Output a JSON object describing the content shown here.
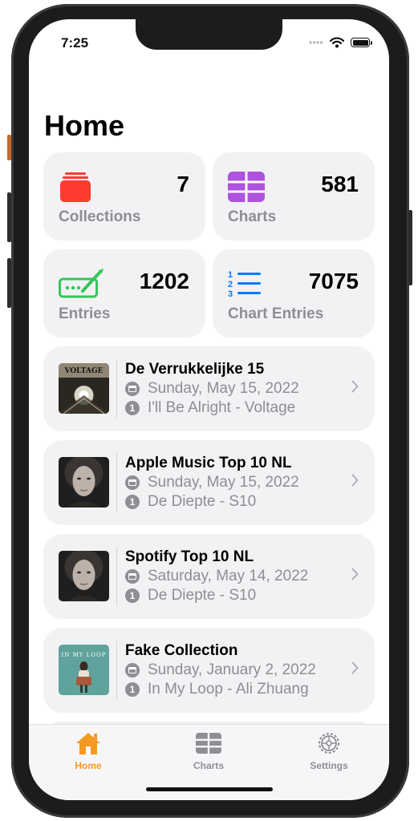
{
  "status": {
    "time": "7:25"
  },
  "page_title": "Home",
  "stats": [
    {
      "label": "Collections",
      "value": "7",
      "icon": "collections-icon",
      "color": "#ff3b30"
    },
    {
      "label": "Charts",
      "value": "581",
      "icon": "charts-grid-icon",
      "color": "#af52de"
    },
    {
      "label": "Entries",
      "value": "1202",
      "icon": "entries-icon",
      "color": "#34c759"
    },
    {
      "label": "Chart Entries",
      "value": "7075",
      "icon": "numbered-list-icon",
      "color": "#007aff"
    }
  ],
  "charts": [
    {
      "title": "De Verrukkelijke 15",
      "date": "Sunday, May 15, 2022",
      "rank": "1",
      "top_entry": "I'll Be Alright - Voltage",
      "artwork_text": "VOLTAGE"
    },
    {
      "title": "Apple Music Top 10 NL",
      "date": "Sunday, May 15, 2022",
      "rank": "1",
      "top_entry": "De Diepte - S10"
    },
    {
      "title": "Spotify Top 10 NL",
      "date": "Saturday, May 14, 2022",
      "rank": "1",
      "top_entry": "De Diepte - S10"
    },
    {
      "title": "Fake Collection",
      "date": "Sunday, January 2, 2022",
      "rank": "1",
      "top_entry": "In My Loop - Ali Zhuang",
      "artwork_text": "IN MY LOOP"
    }
  ],
  "tabs": [
    {
      "label": "Home",
      "active": true
    },
    {
      "label": "Charts",
      "active": false
    },
    {
      "label": "Settings",
      "active": false
    }
  ],
  "colors": {
    "accent": "#f39a25",
    "secondary_text": "#8e8e93",
    "card_bg": "#f2f2f4"
  }
}
